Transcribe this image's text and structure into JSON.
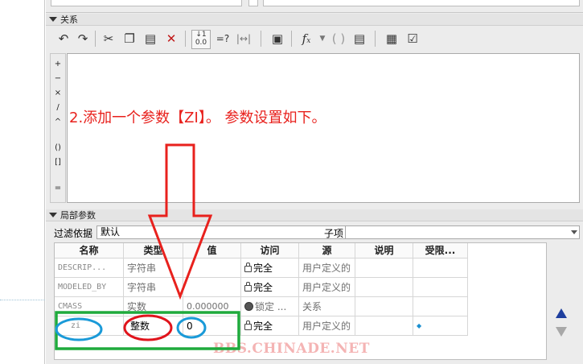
{
  "relations_panel": {
    "header": "关系",
    "toolbar": [
      "undo-icon",
      "redo-icon",
      "cut-icon",
      "copy-icon",
      "paste-icon",
      "delete-icon",
      "insert-parameter-icon",
      "evaluate-icon",
      "dimension-icon",
      "verify-relations-icon",
      "function-icon",
      "parentheses-icon",
      "sort-relations-icon",
      "import-relations-icon",
      "check-relations-icon"
    ],
    "operators": [
      "+",
      "−",
      "×",
      "/",
      "^",
      "()",
      "[]",
      "="
    ]
  },
  "annotation": "2.添加一个参数【ZI】。 参数设置如下。",
  "local_params": {
    "header": "局部参数",
    "filter_label": "过滤依据",
    "filter_value": "默认",
    "child_label": "子项",
    "columns": [
      "名称",
      "类型",
      "值",
      "访问",
      "源",
      "说明",
      "受限..."
    ],
    "rows": [
      {
        "name": "DESCRIP...",
        "type": "字符串",
        "value": "",
        "access": "完全",
        "access_icon": "lock-open-icon",
        "source": "用户定义的",
        "desc": "",
        "restricted": ""
      },
      {
        "name": "MODELED_BY",
        "type": "字符串",
        "value": "",
        "access": "完全",
        "access_icon": "lock-open-icon",
        "source": "用户定义的",
        "desc": "",
        "restricted": ""
      },
      {
        "name": "CMASS",
        "type": "实数",
        "value": "0.000000",
        "access": "锁定 ...",
        "access_icon": "locked-icon",
        "source": "关系",
        "desc": "",
        "restricted": ""
      },
      {
        "name": "zi",
        "type": "整数",
        "value": "0",
        "access": "完全",
        "access_icon": "lock-open-icon",
        "source": "用户定义的",
        "desc": "",
        "restricted": "◆"
      }
    ]
  },
  "watermark": "BBS.CHINADE.NET",
  "colors": {
    "annotation_red": "#e8211d",
    "arrow_red": "#e8211d",
    "highlight_green": "#1faa3c",
    "circle_blue": "#1a9ad8",
    "circle_red": "#e0141c"
  }
}
